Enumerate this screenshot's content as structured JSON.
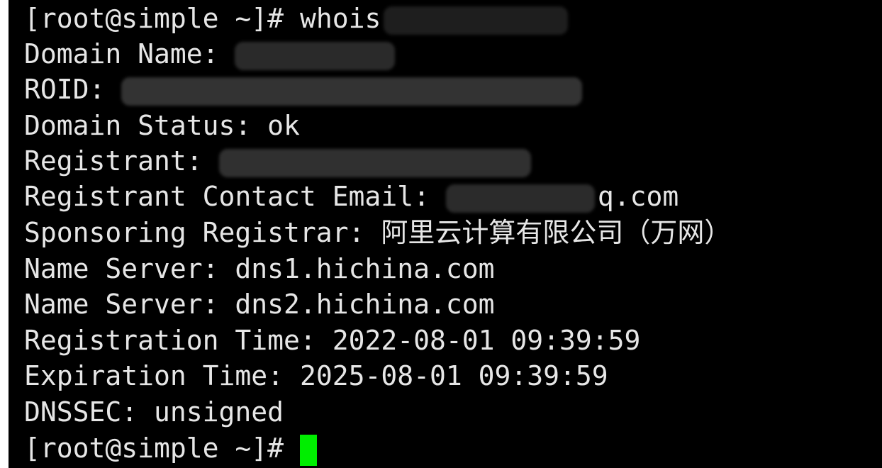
{
  "terminal": {
    "prompt": "[root@simple ~]# ",
    "command": "whois",
    "lines": [
      {
        "label": "Domain Name: ",
        "value": ""
      },
      {
        "label": "ROID: ",
        "value": ""
      },
      {
        "label": "Domain Status: ",
        "value": "ok"
      },
      {
        "label": "Registrant: ",
        "value": ""
      },
      {
        "label": "Registrant Contact Email: ",
        "value": "q.com"
      },
      {
        "label": "Sponsoring Registrar: ",
        "value": "阿里云计算有限公司（万网）"
      },
      {
        "label": "Name Server: ",
        "value": "dns1.hichina.com"
      },
      {
        "label": "Name Server: ",
        "value": "dns2.hichina.com"
      },
      {
        "label": "Registration Time: ",
        "value": "2022-08-01 09:39:59"
      },
      {
        "label": "Expiration Time: ",
        "value": "2025-08-01 09:39:59"
      },
      {
        "label": "DNSSEC: ",
        "value": "unsigned"
      }
    ],
    "final_prompt": "[root@simple ~]# "
  },
  "colors": {
    "background": "#000000",
    "text": "#e6e6e6",
    "cursor": "#00ee00",
    "redaction": "#2c2c2c"
  }
}
